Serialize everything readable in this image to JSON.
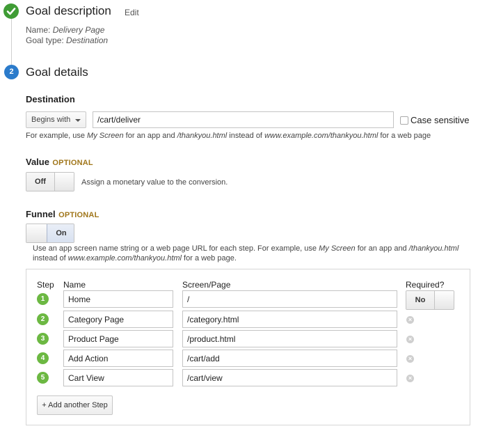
{
  "section1": {
    "title": "Goal description",
    "edit_label": "Edit",
    "name_label": "Name:",
    "name_value": "Delivery Page",
    "type_label": "Goal type:",
    "type_value": "Destination"
  },
  "section2": {
    "step_number": "2",
    "title": "Goal details"
  },
  "destination": {
    "label": "Destination",
    "match_type": "Begins with",
    "value": "/cart/deliver",
    "case_sensitive_label": "Case sensitive",
    "case_sensitive_checked": false,
    "hint_pre": "For example, use ",
    "hint_em1": "My Screen",
    "hint_mid1": " for an app and ",
    "hint_em2": "/thankyou.html",
    "hint_mid2": " instead of ",
    "hint_em3": "www.example.com/thankyou.html",
    "hint_post": " for a web page"
  },
  "value": {
    "label": "Value",
    "optional": "OPTIONAL",
    "toggle_label": "Off",
    "description": "Assign a monetary value to the conversion."
  },
  "funnel": {
    "label": "Funnel",
    "optional": "OPTIONAL",
    "toggle_label": "On",
    "hint_pre": "Use an app screen name string or a web page URL for each step. For example, use ",
    "hint_em1": "My Screen",
    "hint_mid1": " for an app and ",
    "hint_em2": "/thankyou.html",
    "hint_br": "instead of ",
    "hint_em3": "www.example.com/thankyou.html",
    "hint_post": " for a web page.",
    "columns": {
      "step": "Step",
      "name": "Name",
      "screen": "Screen/Page",
      "required": "Required?"
    },
    "required_toggle": "No",
    "steps": [
      {
        "num": "1",
        "name": "Home",
        "screen": "/"
      },
      {
        "num": "2",
        "name": "Category Page",
        "screen": "/category.html"
      },
      {
        "num": "3",
        "name": "Product Page",
        "screen": "/product.html"
      },
      {
        "num": "4",
        "name": "Add Action",
        "screen": "/cart/add"
      },
      {
        "num": "5",
        "name": "Cart View",
        "screen": "/cart/view"
      }
    ],
    "add_step_label": "+ Add another Step"
  },
  "colors": {
    "done": "#3f9c35",
    "active": "#2b7bcb",
    "step_badge": "#6cb842",
    "optional": "#a0761a"
  }
}
